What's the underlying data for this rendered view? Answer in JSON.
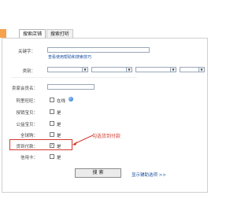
{
  "tabs": [
    {
      "label": "搜索店铺",
      "active": true
    },
    {
      "label": "搜索打听",
      "active": false
    }
  ],
  "form": {
    "keyword_label": "关键字：",
    "search_tips_link": "查看使用帮助和搜索技巧",
    "category_label": "类别：",
    "seller_label": "卖家会员名：",
    "aliwangwang_label": "阿里旺旺：",
    "aliwangwang_online": "在线",
    "xiaobao_label": "授销宝贝：",
    "xiaobao_yes": "是",
    "gongyi_label": "公益宝贝：",
    "gongyi_yes": "是",
    "quanqiugou_label": "全球购：",
    "quanqiugou_yes": "是",
    "huodaofukuan_label": "货到付款：",
    "huodaofukuan_yes": "是",
    "xinyongka_label": "信用卡：",
    "xinyongka_yes": "是"
  },
  "annotation": {
    "text": "勾选货到付款",
    "color": "#d23a2f"
  },
  "buttons": {
    "search_label": "搜 索"
  },
  "links": {
    "show_more": "显示辅助选项 >>"
  }
}
